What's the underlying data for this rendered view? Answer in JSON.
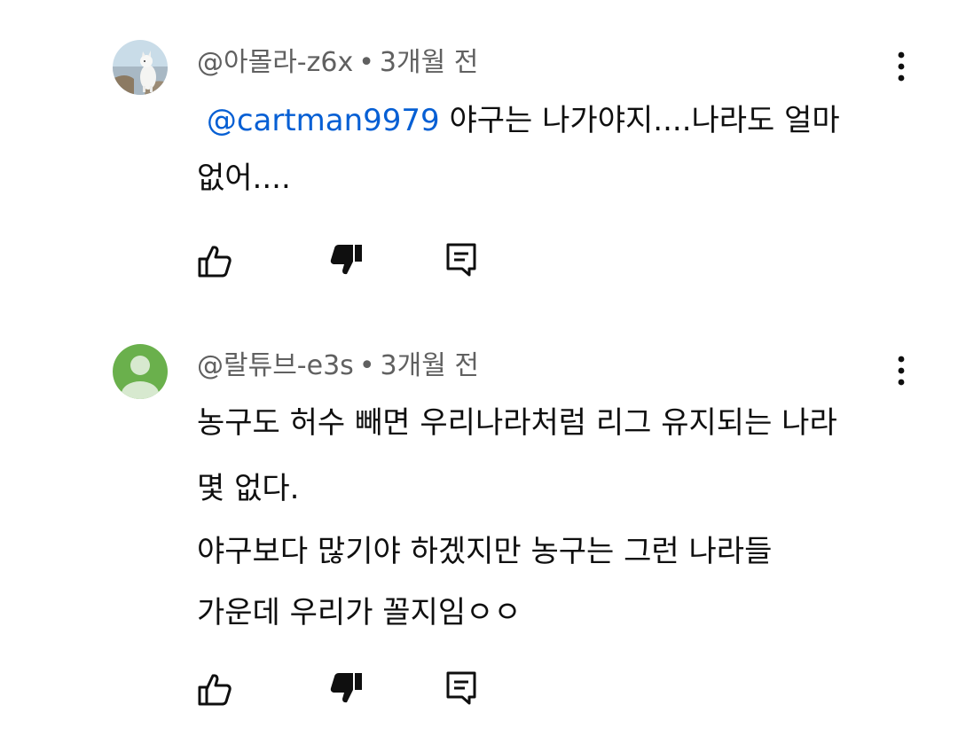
{
  "comments": [
    {
      "author": "@아몰라-z6x",
      "separator": "•",
      "time": "3개월 전",
      "mention": "@cartman9979",
      "lines": [
        "야구는 나가야지....나라도 얼마",
        "없어...."
      ],
      "avatar_icon": "dog-photo-avatar",
      "actions": [
        "like-icon",
        "dislike-icon",
        "reply-icon"
      ]
    },
    {
      "author": "@랄튜브-e3s",
      "separator": "•",
      "time": "3개월 전",
      "lines": [
        "농구도 허수 빼면 우리나라처럼 리그 유지되는 나라",
        "몇 없다.",
        "야구보다 많기야 하겠지만 농구는 그런 나라들",
        "가운데 우리가 꼴지임ㅇㅇ"
      ],
      "avatar_icon": "default-person-avatar",
      "avatar_color": "#6ab04c",
      "actions": [
        "like-icon",
        "dislike-icon",
        "reply-icon"
      ]
    }
  ],
  "colors": {
    "text": "#0f0f0f",
    "meta": "#606060",
    "mention": "#065fd4"
  }
}
